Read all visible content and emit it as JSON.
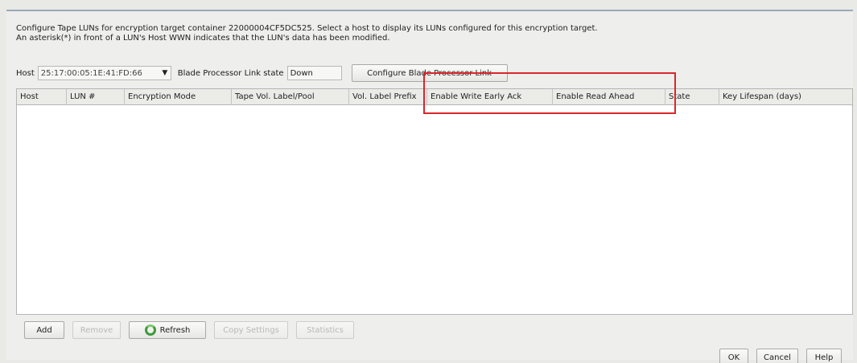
{
  "description": {
    "line1": "Configure Tape LUNs for encryption target container 22000004CF5DC525. Select a host to display its LUNs configured for this encryption target.",
    "line2": "An asterisk(*) in front of a LUN's Host WWN indicates that the LUN's data has been modified."
  },
  "host_row": {
    "host_label": "Host",
    "host_value": "25:17:00:05:1E:41:FD:66",
    "link_state_label": "Blade Processor Link state",
    "link_state_value": "Down",
    "configure_button": "Configure Blade Processor Link"
  },
  "table": {
    "columns": [
      "Host",
      "LUN #",
      "Encryption Mode",
      "Tape Vol. Label/Pool",
      "Vol. Label Prefix",
      "Enable Write Early Ack",
      "Enable Read Ahead",
      "State",
      "Key Lifespan (days)"
    ],
    "rows": []
  },
  "actions": {
    "add": "Add",
    "remove": "Remove",
    "refresh": "Refresh",
    "copy_settings": "Copy Settings",
    "statistics": "Statistics"
  },
  "footer": {
    "ok": "OK",
    "cancel": "Cancel",
    "help": "Help"
  },
  "colors": {
    "highlight": "#d9262b",
    "refresh_icon": "#3d9a3a"
  }
}
